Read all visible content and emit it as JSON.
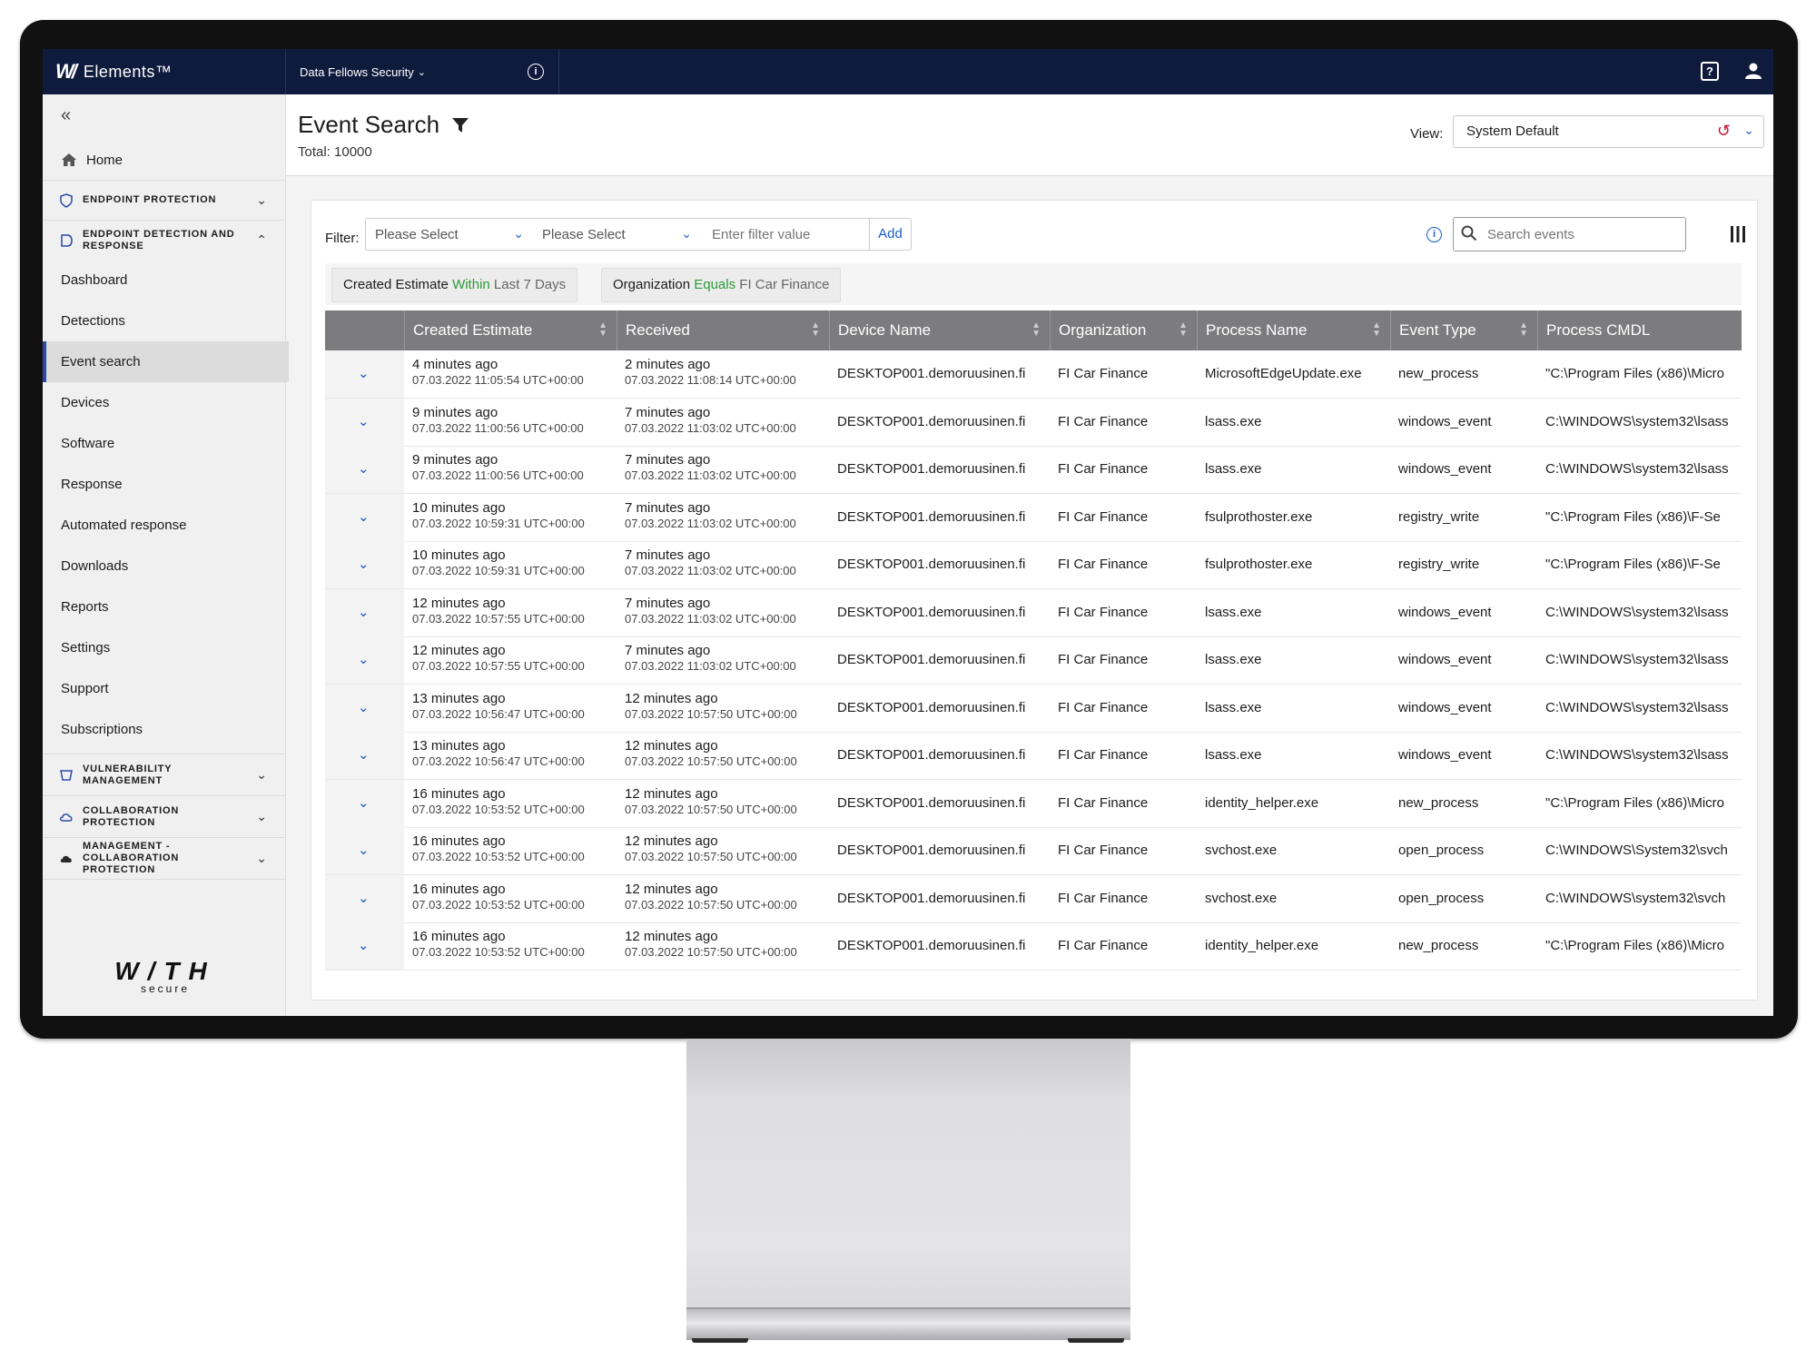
{
  "topbar": {
    "brand_mark": "W/",
    "brand_name": "Elements™",
    "org_label": "Data Fellows Security",
    "org_chevron": "⌄",
    "info_glyph": "i",
    "help_glyph": "?"
  },
  "sidebar": {
    "collapse_glyph": "«",
    "home": "Home",
    "groups": {
      "endpoint_protection": "ENDPOINT PROTECTION",
      "edr": "ENDPOINT DETECTION AND RESPONSE",
      "vulnerability": "VULNERABILITY MANAGEMENT",
      "collaboration": "COLLABORATION PROTECTION",
      "management": "MANAGEMENT - COLLABORATION PROTECTION"
    },
    "items": [
      "Dashboard",
      "Detections",
      "Event search",
      "Devices",
      "Software",
      "Response",
      "Automated response",
      "Downloads",
      "Reports",
      "Settings",
      "Support",
      "Subscriptions"
    ],
    "active_item": "Event search",
    "logo_big": "W/TH",
    "logo_small": "secure"
  },
  "header": {
    "title": "Event Search",
    "total": "Total: 10000",
    "view_label": "View:",
    "view_value": "System Default"
  },
  "filter": {
    "label": "Filter:",
    "select1": "Please Select",
    "select2": "Please Select",
    "value_placeholder": "Enter filter value",
    "add": "Add",
    "search_placeholder": "Search events"
  },
  "chips": [
    {
      "field": "Created Estimate",
      "op": "Within",
      "value": "Last 7 Days"
    },
    {
      "field": "Organization",
      "op": "Equals",
      "value": "FI Car Finance"
    }
  ],
  "table": {
    "columns": [
      "Created Estimate",
      "Received",
      "Device Name",
      "Organization",
      "Process Name",
      "Event Type",
      "Process CMDL"
    ],
    "rows": [
      {
        "created_rel": "4 minutes ago",
        "created_abs": "07.03.2022 11:05:54 UTC+00:00",
        "received_rel": "2 minutes ago",
        "received_abs": "07.03.2022 11:08:14 UTC+00:00",
        "device": "DESKTOP001.demoruusinen.fi",
        "org": "FI Car Finance",
        "process": "MicrosoftEdgeUpdate.exe",
        "event": "new_process",
        "cmdl": "\"C:\\Program Files (x86)\\Micro"
      },
      {
        "created_rel": "9 minutes ago",
        "created_abs": "07.03.2022 11:00:56 UTC+00:00",
        "received_rel": "7 minutes ago",
        "received_abs": "07.03.2022 11:03:02 UTC+00:00",
        "device": "DESKTOP001.demoruusinen.fi",
        "org": "FI Car Finance",
        "process": "lsass.exe",
        "event": "windows_event",
        "cmdl": "C:\\WINDOWS\\system32\\lsass"
      },
      {
        "created_rel": "9 minutes ago",
        "created_abs": "07.03.2022 11:00:56 UTC+00:00",
        "received_rel": "7 minutes ago",
        "received_abs": "07.03.2022 11:03:02 UTC+00:00",
        "device": "DESKTOP001.demoruusinen.fi",
        "org": "FI Car Finance",
        "process": "lsass.exe",
        "event": "windows_event",
        "cmdl": "C:\\WINDOWS\\system32\\lsass"
      },
      {
        "created_rel": "10 minutes ago",
        "created_abs": "07.03.2022 10:59:31 UTC+00:00",
        "received_rel": "7 minutes ago",
        "received_abs": "07.03.2022 11:03:02 UTC+00:00",
        "device": "DESKTOP001.demoruusinen.fi",
        "org": "FI Car Finance",
        "process": "fsulprothoster.exe",
        "event": "registry_write",
        "cmdl": "\"C:\\Program Files (x86)\\F-Se"
      },
      {
        "created_rel": "10 minutes ago",
        "created_abs": "07.03.2022 10:59:31 UTC+00:00",
        "received_rel": "7 minutes ago",
        "received_abs": "07.03.2022 11:03:02 UTC+00:00",
        "device": "DESKTOP001.demoruusinen.fi",
        "org": "FI Car Finance",
        "process": "fsulprothoster.exe",
        "event": "registry_write",
        "cmdl": "\"C:\\Program Files (x86)\\F-Se"
      },
      {
        "created_rel": "12 minutes ago",
        "created_abs": "07.03.2022 10:57:55 UTC+00:00",
        "received_rel": "7 minutes ago",
        "received_abs": "07.03.2022 11:03:02 UTC+00:00",
        "device": "DESKTOP001.demoruusinen.fi",
        "org": "FI Car Finance",
        "process": "lsass.exe",
        "event": "windows_event",
        "cmdl": "C:\\WINDOWS\\system32\\lsass"
      },
      {
        "created_rel": "12 minutes ago",
        "created_abs": "07.03.2022 10:57:55 UTC+00:00",
        "received_rel": "7 minutes ago",
        "received_abs": "07.03.2022 11:03:02 UTC+00:00",
        "device": "DESKTOP001.demoruusinen.fi",
        "org": "FI Car Finance",
        "process": "lsass.exe",
        "event": "windows_event",
        "cmdl": "C:\\WINDOWS\\system32\\lsass"
      },
      {
        "created_rel": "13 minutes ago",
        "created_abs": "07.03.2022 10:56:47 UTC+00:00",
        "received_rel": "12 minutes ago",
        "received_abs": "07.03.2022 10:57:50 UTC+00:00",
        "device": "DESKTOP001.demoruusinen.fi",
        "org": "FI Car Finance",
        "process": "lsass.exe",
        "event": "windows_event",
        "cmdl": "C:\\WINDOWS\\system32\\lsass"
      },
      {
        "created_rel": "13 minutes ago",
        "created_abs": "07.03.2022 10:56:47 UTC+00:00",
        "received_rel": "12 minutes ago",
        "received_abs": "07.03.2022 10:57:50 UTC+00:00",
        "device": "DESKTOP001.demoruusinen.fi",
        "org": "FI Car Finance",
        "process": "lsass.exe",
        "event": "windows_event",
        "cmdl": "C:\\WINDOWS\\system32\\lsass"
      },
      {
        "created_rel": "16 minutes ago",
        "created_abs": "07.03.2022 10:53:52 UTC+00:00",
        "received_rel": "12 minutes ago",
        "received_abs": "07.03.2022 10:57:50 UTC+00:00",
        "device": "DESKTOP001.demoruusinen.fi",
        "org": "FI Car Finance",
        "process": "identity_helper.exe",
        "event": "new_process",
        "cmdl": "\"C:\\Program Files (x86)\\Micro"
      },
      {
        "created_rel": "16 minutes ago",
        "created_abs": "07.03.2022 10:53:52 UTC+00:00",
        "received_rel": "12 minutes ago",
        "received_abs": "07.03.2022 10:57:50 UTC+00:00",
        "device": "DESKTOP001.demoruusinen.fi",
        "org": "FI Car Finance",
        "process": "svchost.exe",
        "event": "open_process",
        "cmdl": "C:\\WINDOWS\\System32\\svch"
      },
      {
        "created_rel": "16 minutes ago",
        "created_abs": "07.03.2022 10:53:52 UTC+00:00",
        "received_rel": "12 minutes ago",
        "received_abs": "07.03.2022 10:57:50 UTC+00:00",
        "device": "DESKTOP001.demoruusinen.fi",
        "org": "FI Car Finance",
        "process": "svchost.exe",
        "event": "open_process",
        "cmdl": "C:\\WINDOWS\\system32\\svch"
      },
      {
        "created_rel": "16 minutes ago",
        "created_abs": "07.03.2022 10:53:52 UTC+00:00",
        "received_rel": "12 minutes ago",
        "received_abs": "07.03.2022 10:57:50 UTC+00:00",
        "device": "DESKTOP001.demoruusinen.fi",
        "org": "FI Car Finance",
        "process": "identity_helper.exe",
        "event": "new_process",
        "cmdl": "\"C:\\Program Files (x86)\\Micro"
      }
    ]
  },
  "colors": {
    "topbar": "#0f1b3d",
    "accent": "#1a5dc8",
    "header_bg": "#7c7c7e",
    "operator_green": "#2d9a3a",
    "reset_red": "#c8102e"
  },
  "icons": [
    "info-icon",
    "help-icon",
    "user-icon",
    "home-icon",
    "shield-icon",
    "funnel-icon",
    "search-icon",
    "columns-icon",
    "refresh-icon",
    "chevron-down-icon"
  ]
}
